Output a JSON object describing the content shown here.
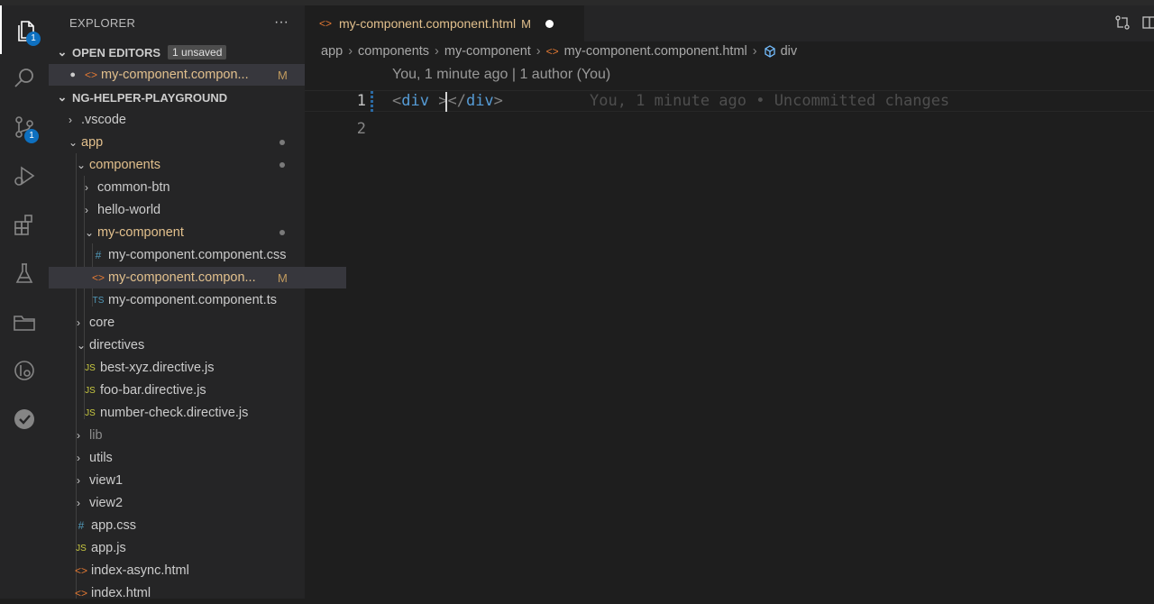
{
  "activity_bar": {
    "explorer_badge": "1",
    "scm_badge": "1"
  },
  "sidebar": {
    "title": "EXPLORER",
    "more": "···",
    "open_editors": {
      "label": "OPEN EDITORS",
      "badge": "1 unsaved",
      "items": [
        {
          "name": "my-component.compon...",
          "status": "M"
        }
      ]
    },
    "workspace": {
      "label": "NG-HELPER-PLAYGROUND"
    },
    "tree": [
      {
        "label": ".vscode"
      },
      {
        "label": "app"
      },
      {
        "label": "components"
      },
      {
        "label": "common-btn"
      },
      {
        "label": "hello-world"
      },
      {
        "label": "my-component"
      },
      {
        "label": "my-component.component.css",
        "icon": "#"
      },
      {
        "label": "my-component.compon...",
        "icon": "<>",
        "status": "M"
      },
      {
        "label": "my-component.component.ts",
        "icon": "TS"
      },
      {
        "label": "core"
      },
      {
        "label": "directives"
      },
      {
        "label": "best-xyz.directive.js",
        "icon": "JS"
      },
      {
        "label": "foo-bar.directive.js",
        "icon": "JS"
      },
      {
        "label": "number-check.directive.js",
        "icon": "JS"
      },
      {
        "label": "lib"
      },
      {
        "label": "utils"
      },
      {
        "label": "view1"
      },
      {
        "label": "view2"
      },
      {
        "label": "app.css",
        "icon": "#"
      },
      {
        "label": "app.js",
        "icon": "JS"
      },
      {
        "label": "index-async.html",
        "icon": "<>"
      },
      {
        "label": "index.html",
        "icon": "<>"
      }
    ]
  },
  "editor": {
    "tab": {
      "icon": "<>",
      "name": "my-component.component.html",
      "status": "M"
    },
    "breadcrumb": [
      "app",
      "components",
      "my-component",
      "my-component.component.html",
      "div"
    ],
    "codelens": "You, 1 minute ago | 1 author (You)",
    "line_numbers": [
      "1",
      "2"
    ],
    "code": {
      "open_lt": "<",
      "open_tag": "div",
      "space": " ",
      "open_gt": ">",
      "close_lt": "</",
      "close_tag": "div",
      "close_gt": ">"
    },
    "blame": "You, 1 minute ago • Uncommitted changes"
  }
}
